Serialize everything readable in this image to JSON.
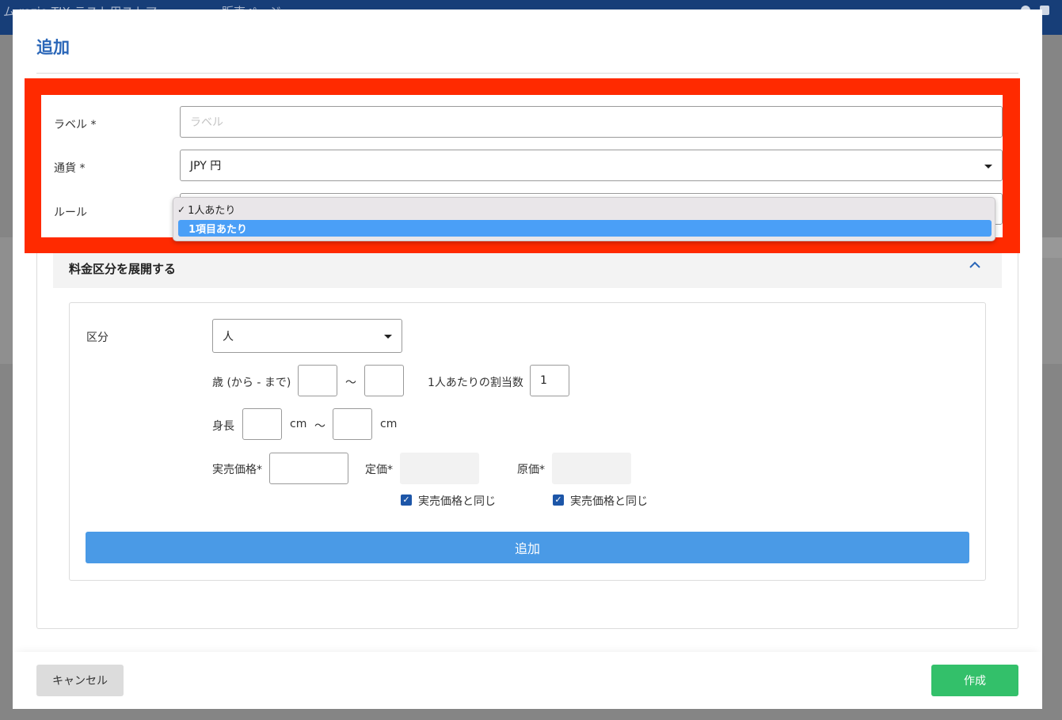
{
  "background": {
    "header_text": "ム rezio TIX テスト用ストア",
    "header_page": "販売ページ"
  },
  "modal": {
    "title": "追加",
    "label_field": {
      "label": "ラベル *",
      "placeholder": "ラベル",
      "value": ""
    },
    "currency_field": {
      "label": "通貨 *",
      "value": "JPY 円"
    },
    "rule_field": {
      "label": "ルール",
      "options": [
        {
          "label": "1人あたり",
          "checked": true,
          "highlighted": false
        },
        {
          "label": "1項目あたり",
          "checked": false,
          "highlighted": true
        }
      ]
    },
    "section": {
      "title": "料金区分を展開する",
      "chevron": "^"
    },
    "category": {
      "label": "区分",
      "value": "人",
      "age_label": "歳 (から - まで)",
      "age_from": "",
      "age_to": "",
      "range_separator": "〜",
      "per_person_label": "1人あたりの割当数",
      "per_person_value": "1",
      "height_label": "身長",
      "height_from": "",
      "height_to": "",
      "height_unit": "cm",
      "actual_price_label": "実売価格*",
      "actual_price_value": "",
      "list_price_label": "定価*",
      "cost_price_label": "原価*",
      "same_as_actual_label": "実売価格と同じ",
      "list_same_checked": true,
      "cost_same_checked": true,
      "add_button": "追加"
    },
    "footer": {
      "cancel": "キャンセル",
      "create": "作成"
    }
  },
  "colors": {
    "accent": "#2a66b8",
    "highlight_box": "#ff2a00",
    "add_button": "#4a9ae6",
    "create_button": "#33c06a",
    "selected_option": "#4a9ff7"
  }
}
